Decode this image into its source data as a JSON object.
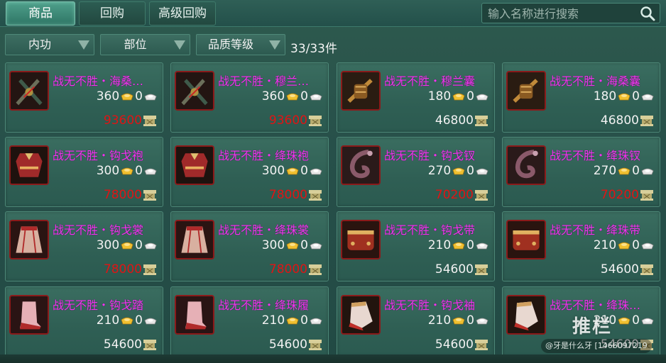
{
  "tabs": [
    {
      "label": "商品",
      "active": true
    },
    {
      "label": "回购",
      "active": false
    },
    {
      "label": "高级回购",
      "active": false
    }
  ],
  "search": {
    "placeholder": "输入名称进行搜索",
    "value": ""
  },
  "filters": [
    {
      "label": "内功"
    },
    {
      "label": "部位"
    },
    {
      "label": "品质等级"
    }
  ],
  "count": "33/33件",
  "colors": {
    "name": "#ee39ee",
    "price_red": "#e01414",
    "price_white": "#f2f2f2"
  },
  "items": [
    {
      "name": "战无不胜・海桑…",
      "cost": "360",
      "silver": "0",
      "price": "93600",
      "price_color": "red",
      "icon": "weapon-dual-icon"
    },
    {
      "name": "战无不胜・穆兰…",
      "cost": "360",
      "silver": "0",
      "price": "93600",
      "price_color": "red",
      "icon": "weapon-dual-icon"
    },
    {
      "name": "战无不胜・穆兰囊",
      "cost": "180",
      "silver": "0",
      "price": "46800",
      "price_color": "white",
      "icon": "pouch-icon"
    },
    {
      "name": "战无不胜・海桑囊",
      "cost": "180",
      "silver": "0",
      "price": "46800",
      "price_color": "white",
      "icon": "pouch-icon"
    },
    {
      "name": "战无不胜・钩戈袍",
      "cost": "300",
      "silver": "0",
      "price": "78000",
      "price_color": "red",
      "icon": "robe-icon"
    },
    {
      "name": "战无不胜・绛珠袍",
      "cost": "300",
      "silver": "0",
      "price": "78000",
      "price_color": "red",
      "icon": "robe-icon"
    },
    {
      "name": "战无不胜・钩戈钗",
      "cost": "270",
      "silver": "0",
      "price": "70200",
      "price_color": "red",
      "icon": "hairpin-icon"
    },
    {
      "name": "战无不胜・绛珠钗",
      "cost": "270",
      "silver": "0",
      "price": "70200",
      "price_color": "red",
      "icon": "hairpin-icon"
    },
    {
      "name": "战无不胜・钩戈裳",
      "cost": "300",
      "silver": "0",
      "price": "78000",
      "price_color": "red",
      "icon": "skirt-icon"
    },
    {
      "name": "战无不胜・绛珠裳",
      "cost": "300",
      "silver": "0",
      "price": "78000",
      "price_color": "red",
      "icon": "skirt-icon"
    },
    {
      "name": "战无不胜・钩戈带",
      "cost": "210",
      "silver": "0",
      "price": "54600",
      "price_color": "white",
      "icon": "belt-icon"
    },
    {
      "name": "战无不胜・绛珠带",
      "cost": "210",
      "silver": "0",
      "price": "54600",
      "price_color": "white",
      "icon": "belt-icon"
    },
    {
      "name": "战无不胜・钩戈踏",
      "cost": "210",
      "silver": "0",
      "price": "54600",
      "price_color": "white",
      "icon": "boots-icon"
    },
    {
      "name": "战无不胜・绛珠履",
      "cost": "210",
      "silver": "0",
      "price": "54600",
      "price_color": "white",
      "icon": "boots-icon"
    },
    {
      "name": "战无不胜・钩戈袖",
      "cost": "210",
      "silver": "0",
      "price": "54600",
      "price_color": "white",
      "icon": "sleeve-icon"
    },
    {
      "name": "战无不胜・绛珠…",
      "cost": "210",
      "silver": "0",
      "price": "54600",
      "price_color": "white",
      "icon": "sleeve-icon"
    }
  ],
  "watermark": {
    "logo": "推栏",
    "text": "@牙是什么牙 [1466097219"
  }
}
